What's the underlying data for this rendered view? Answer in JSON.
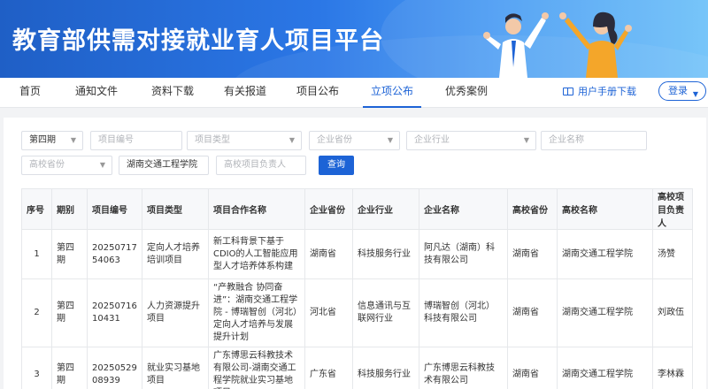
{
  "header": {
    "title": "教育部供需对接就业育人项目平台"
  },
  "nav": {
    "items": [
      "首页",
      "通知文件",
      "资料下载",
      "有关报道",
      "项目公布",
      "立项公布",
      "优秀案例"
    ],
    "active_index": 5,
    "manual": "用户手册下载",
    "login": "登录"
  },
  "filters": {
    "period": "第四期",
    "project_no_ph": "项目编号",
    "project_type_ph": "项目类型",
    "ent_province_ph": "企业省份",
    "ent_industry_ph": "企业行业",
    "ent_name_ph": "企业名称",
    "uni_province_ph": "高校省份",
    "uni_name": "湖南交通工程学院",
    "uni_leader_ph": "高校项目负责人",
    "query": "查询"
  },
  "table": {
    "headers": [
      "序号",
      "期别",
      "项目编号",
      "项目类型",
      "项目合作名称",
      "企业省份",
      "企业行业",
      "企业名称",
      "高校省份",
      "高校名称",
      "高校项目负责人"
    ],
    "rows": [
      [
        "1",
        "第四期",
        "2025071754063",
        "定向人才培养培训项目",
        "新工科背景下基于CDIO的人工智能应用型人才培养体系构建",
        "湖南省",
        "科技服务行业",
        "阿凡达（湖南）科技有限公司",
        "湖南省",
        "湖南交通工程学院",
        "汤赞"
      ],
      [
        "2",
        "第四期",
        "2025071610431",
        "人力资源提升项目",
        "“产教融合 协同奋进”：湖南交通工程学院 - 博瑞智创（河北）定向人才培养与发展提升计划",
        "河北省",
        "信息通讯与互联网行业",
        "博瑞智创（河北）科技有限公司",
        "湖南省",
        "湖南交通工程学院",
        "刘政伍"
      ],
      [
        "3",
        "第四期",
        "2025052908939",
        "就业实习基地项目",
        "广东博思云科教技术有限公司-湖南交通工程学院就业实习基地项目",
        "广东省",
        "科技服务行业",
        "广东博思云科教技术有限公司",
        "湖南省",
        "湖南交通工程学院",
        "李林霖"
      ]
    ]
  }
}
